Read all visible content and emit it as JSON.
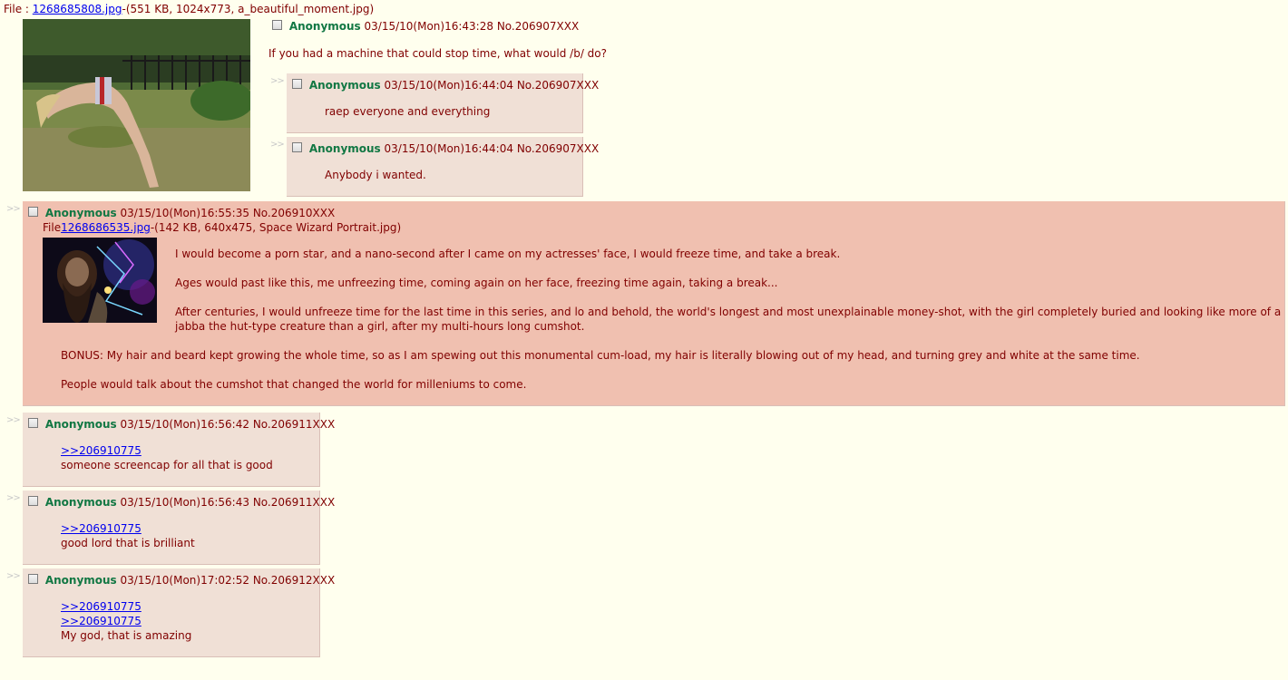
{
  "op": {
    "file_prefix": "File : ",
    "file_link": "1268685808.jpg",
    "file_meta": "-(551 KB, 1024x773, a_beautiful_moment.jpg)",
    "name": "Anonymous",
    "datetime": "03/15/10(Mon)16:43:28",
    "post_no": "No.206907XXX",
    "message": "If you had a machine that could stop time, what would /b/ do?"
  },
  "arrow": ">>",
  "replies": [
    {
      "name": "Anonymous",
      "datetime": "03/15/10(Mon)16:44:04",
      "post_no": "No.206907XXX",
      "lines": [
        "raep everyone and everything"
      ]
    },
    {
      "name": "Anonymous",
      "datetime": "03/15/10(Mon)16:44:04",
      "post_no": "No.206907XXX",
      "lines": [
        "Anybody i wanted."
      ]
    },
    {
      "name": "Anonymous",
      "datetime": "03/15/10(Mon)16:55:35",
      "post_no": "No.206910XXX",
      "file_prefix": "File",
      "file_link": "1268686535.jpg",
      "file_meta": "-(142 KB, 640x475, Space Wizard Portrait.jpg)",
      "lines": [
        "I would become a porn star, and a nano-second after I came on my actresses' face, I would freeze time, and take a break.",
        "Ages would past like this, me unfreezing time, coming again on her face, freezing time again, taking a break...",
        "After centuries, I would unfreeze time for the last time in this series, and lo and behold, the world's longest and most unexplainable money-shot, with the girl completely buried and looking like more of a",
        "jabba the hut-type creature than a girl, after my multi-hours long cumshot.",
        "BONUS: My hair and beard kept growing the whole time, so as I am spewing out this monumental cum-load, my hair is literally blowing out of my head, and turning grey and white at the same time.",
        "People would talk about the cumshot that changed the world for milleniums to come."
      ]
    },
    {
      "name": "Anonymous",
      "datetime": "03/15/10(Mon)16:56:42",
      "post_no": "No.206911XXX",
      "quotes": [
        ">>206910775"
      ],
      "lines": [
        "someone screencap for all that is good"
      ]
    },
    {
      "name": "Anonymous",
      "datetime": "03/15/10(Mon)16:56:43",
      "post_no": "No.206911XXX",
      "quotes": [
        ">>206910775"
      ],
      "lines": [
        "good lord that is brilliant"
      ]
    },
    {
      "name": "Anonymous",
      "datetime": "03/15/10(Mon)17:02:52",
      "post_no": "No.206912XXX",
      "quotes": [
        ">>206910775",
        ">>206910775"
      ],
      "lines": [
        "My god, that is amazing"
      ]
    }
  ],
  "colors": {
    "background": "#FFFFEE",
    "text": "#800000",
    "name": "#117743",
    "reply": "#F0E0D6",
    "reply_highlight": "#F0C0B0",
    "link": "#0000EE"
  }
}
